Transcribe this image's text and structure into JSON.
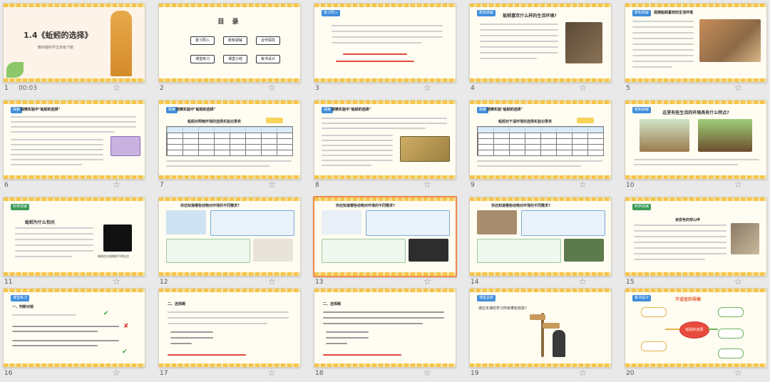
{
  "app": {
    "title": "蚯蚓的选择 slide sorter"
  },
  "selected_slide": 13,
  "slides": [
    {
      "num": "1",
      "time": "00:03",
      "title": "1.4《蚯蚓的选择》",
      "subtitle": "教科版科学五年级下册"
    },
    {
      "num": "2",
      "heading": "目 录",
      "buttons": [
        "复习导入",
        "新知讲解",
        "合作探究",
        "课堂练习",
        "课堂小结",
        "板书设计"
      ]
    },
    {
      "num": "3",
      "tag": "复习导入"
    },
    {
      "num": "4",
      "tag": "新知讲解",
      "title": "蚯蚓喜欢什么样的生活环境?"
    },
    {
      "num": "5",
      "tag": "新知讲解",
      "title": "观测蚯蚓喜欢的生活环境"
    },
    {
      "num": "6",
      "tag": "探索",
      "title": "观察实验中\"蚯蚓的选择\""
    },
    {
      "num": "7",
      "tag": "探索",
      "title": "观察实验中\"蚯蚓的选择\"",
      "table_title": "蚯蚓对明暗环境的选择实验记录表"
    },
    {
      "num": "8",
      "tag": "探索",
      "title": "观察实验中\"蚯蚓的选择\""
    },
    {
      "num": "9",
      "tag": "探索",
      "title": "观察实验\"蚯蚓的选择\"",
      "table_title": "蚯蚓对干湿环境的选择实验记录表"
    },
    {
      "num": "10",
      "tag": "新知讲解",
      "title": "这里有些生活的环境具有什么特点?"
    },
    {
      "num": "11",
      "tag": "科学阅读",
      "title": "蚯蚓为什么怕光",
      "caption": "蚯蚓在光线照射下的反应"
    },
    {
      "num": "12",
      "title": "你还知道哪些动物对环境的不同需求?"
    },
    {
      "num": "13",
      "title": "你还知道哪些动物对环境的不同需求?"
    },
    {
      "num": "14",
      "title": "你还知道哪些动物对环境的不同需求?"
    },
    {
      "num": "15",
      "tag": "科学阅读",
      "title": "会变色的穿山甲"
    },
    {
      "num": "16",
      "tag": "课堂练习",
      "heading": "一、判断对错"
    },
    {
      "num": "17",
      "heading": "二、选择题"
    },
    {
      "num": "18",
      "heading": "二、选择题"
    },
    {
      "num": "19",
      "tag": "课堂总结",
      "question": "通过本课的学习你有哪些收获?"
    },
    {
      "num": "20",
      "tag": "板书设计",
      "title": "不适宜的导图",
      "center": "蚯蚓的选择"
    }
  ],
  "ui": {
    "star_glyph": "☆",
    "accent_color": "#f08a4b"
  }
}
